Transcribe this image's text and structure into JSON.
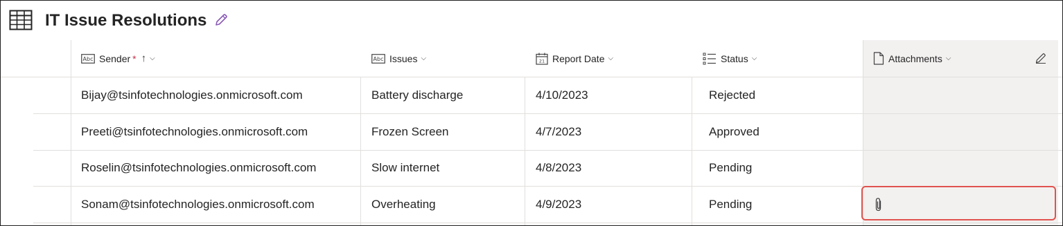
{
  "title": {
    "text": "IT Issue Resolutions",
    "icon": "table-grid-icon",
    "edit_icon": "pencil-icon"
  },
  "columns": {
    "sender": {
      "label": "Sender",
      "required_mark": "*",
      "sort": "↑",
      "icon": "text-field-icon"
    },
    "issues": {
      "label": "Issues",
      "icon": "text-field-icon"
    },
    "report_date": {
      "label": "Report Date",
      "icon": "calendar-icon"
    },
    "status": {
      "label": "Status",
      "icon": "choice-list-icon"
    },
    "attachments": {
      "label": "Attachments",
      "icon": "document-icon",
      "edit_icon": "pencil-icon"
    }
  },
  "rows": [
    {
      "sender": "Bijay@tsinfotechnologies.onmicrosoft.com",
      "issues": "Battery discharge",
      "report_date": "4/10/2023",
      "status": "Rejected",
      "attachment": false
    },
    {
      "sender": "Preeti@tsinfotechnologies.onmicrosoft.com",
      "issues": "Frozen Screen",
      "report_date": "4/7/2023",
      "status": "Approved",
      "attachment": false
    },
    {
      "sender": "Roselin@tsinfotechnologies.onmicrosoft.com",
      "issues": "Slow internet",
      "report_date": "4/8/2023",
      "status": "Pending",
      "attachment": false
    },
    {
      "sender": "Sonam@tsinfotechnologies.onmicrosoft.com",
      "issues": "Overheating",
      "report_date": "4/9/2023",
      "status": "Pending",
      "attachment": true
    }
  ],
  "colors": {
    "highlight_border": "#e0524d",
    "required_star": "#c4314b",
    "title_edit_icon": "#8a5ab5",
    "attachments_column_bg": "#f3f1f0"
  }
}
